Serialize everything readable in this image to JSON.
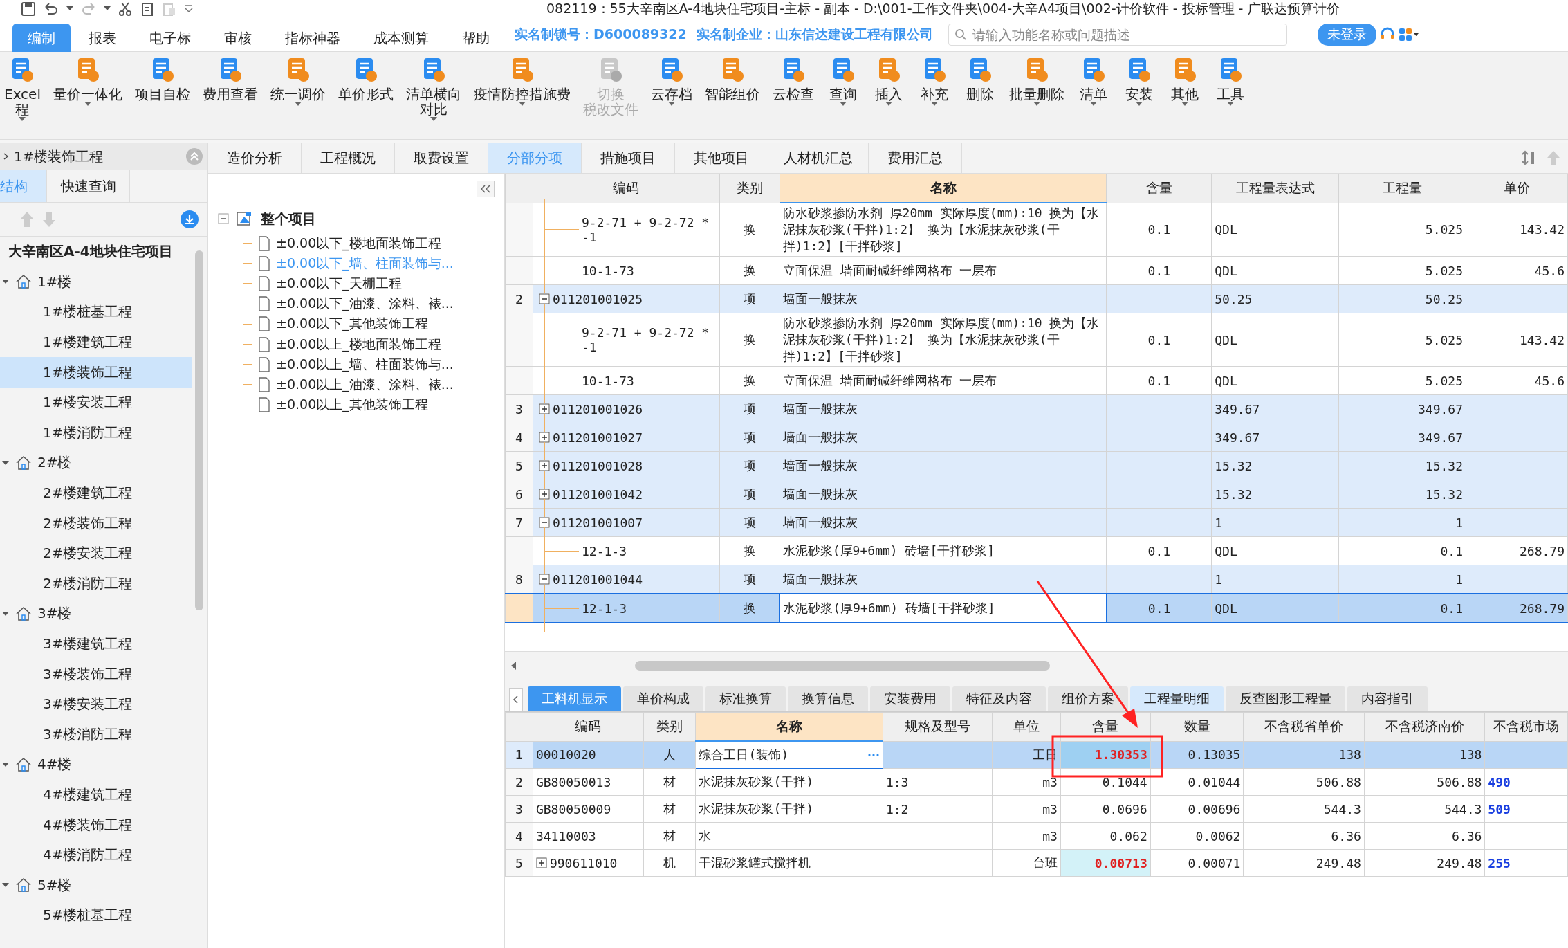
{
  "window": {
    "title": "082119：55大辛南区A-4地块住宅项目-主标 - 副本 - D:\\001-工作文件夹\\004-大辛A4项目\\002-计价软件 - 投标管理 - 广联达预算计价"
  },
  "menu": {
    "tabs": [
      {
        "label": "编制",
        "selected": true
      },
      {
        "label": "报表",
        "selected": false
      },
      {
        "label": "电子标",
        "selected": false
      },
      {
        "label": "审核",
        "selected": false
      },
      {
        "label": "指标神器",
        "selected": false
      },
      {
        "label": "成本测算",
        "selected": false
      },
      {
        "label": "帮助",
        "selected": false
      }
    ],
    "lock_label": "实名制锁号：",
    "lock_value": "D600089322",
    "company_label": "实名制企业：",
    "company_value": "山东信达建设工程有限公司",
    "search": {
      "placeholder": "请输入功能名称或问题描述"
    },
    "login_button": "未登录"
  },
  "toolbar": [
    {
      "lines": [
        "Excel",
        "程"
      ],
      "dropdown": true,
      "disabled": false
    },
    {
      "lines": [
        "量价一体化"
      ],
      "dropdown": true,
      "disabled": false
    },
    {
      "lines": [
        "项目自检"
      ],
      "dropdown": false,
      "disabled": false
    },
    {
      "lines": [
        "费用查看"
      ],
      "dropdown": false,
      "disabled": false
    },
    {
      "lines": [
        "统一调价"
      ],
      "dropdown": true,
      "disabled": false
    },
    {
      "lines": [
        "单价形式"
      ],
      "dropdown": false,
      "disabled": false
    },
    {
      "lines": [
        "清单横向",
        "对比"
      ],
      "dropdown": true,
      "disabled": false
    },
    {
      "lines": [
        "疫情防控措施费"
      ],
      "dropdown": true,
      "disabled": false
    },
    {
      "lines": [
        "切换",
        "税改文件"
      ],
      "dropdown": false,
      "disabled": true
    },
    {
      "lines": [
        "云存档"
      ],
      "dropdown": true,
      "disabled": false
    },
    {
      "lines": [
        "智能组价"
      ],
      "dropdown": false,
      "disabled": false
    },
    {
      "lines": [
        "云检查"
      ],
      "dropdown": false,
      "disabled": false
    },
    {
      "lines": [
        "查询"
      ],
      "dropdown": true,
      "disabled": false
    },
    {
      "lines": [
        "插入"
      ],
      "dropdown": true,
      "disabled": false
    },
    {
      "lines": [
        "补充"
      ],
      "dropdown": true,
      "disabled": false
    },
    {
      "lines": [
        "删除"
      ],
      "dropdown": false,
      "disabled": false
    },
    {
      "lines": [
        "批量删除"
      ],
      "dropdown": true,
      "disabled": false
    },
    {
      "lines": [
        "清单"
      ],
      "dropdown": true,
      "disabled": false
    },
    {
      "lines": [
        "安装"
      ],
      "dropdown": true,
      "disabled": false
    },
    {
      "lines": [
        "其他"
      ],
      "dropdown": true,
      "disabled": false
    },
    {
      "lines": [
        "工具"
      ],
      "dropdown": true,
      "disabled": false
    }
  ],
  "left_panel": {
    "header": "1#楼装饰工程",
    "tabs": [
      {
        "label": "结构",
        "selected": true
      },
      {
        "label": "快速查询",
        "selected": false
      }
    ],
    "tree": {
      "label": "大辛南区A-4地块住宅项目",
      "children": [
        {
          "label": "1#楼",
          "expanded": true,
          "children": [
            {
              "label": "1#楼桩基工程",
              "selected": false
            },
            {
              "label": "1#楼建筑工程",
              "selected": false
            },
            {
              "label": "1#楼装饰工程",
              "selected": true
            },
            {
              "label": "1#楼安装工程",
              "selected": false
            },
            {
              "label": "1#楼消防工程",
              "selected": false
            }
          ]
        },
        {
          "label": "2#楼",
          "expanded": true,
          "children": [
            {
              "label": "2#楼建筑工程",
              "selected": false
            },
            {
              "label": "2#楼装饰工程",
              "selected": false
            },
            {
              "label": "2#楼安装工程",
              "selected": false
            },
            {
              "label": "2#楼消防工程",
              "selected": false
            }
          ]
        },
        {
          "label": "3#楼",
          "expanded": true,
          "children": [
            {
              "label": "3#楼建筑工程",
              "selected": false
            },
            {
              "label": "3#楼装饰工程",
              "selected": false
            },
            {
              "label": "3#楼安装工程",
              "selected": false
            },
            {
              "label": "3#楼消防工程",
              "selected": false
            }
          ]
        },
        {
          "label": "4#楼",
          "expanded": true,
          "children": [
            {
              "label": "4#楼建筑工程",
              "selected": false
            },
            {
              "label": "4#楼装饰工程",
              "selected": false
            },
            {
              "label": "4#楼消防工程",
              "selected": false
            }
          ]
        },
        {
          "label": "5#楼",
          "expanded": true,
          "children": [
            {
              "label": "5#楼桩基工程",
              "selected": false
            }
          ]
        }
      ]
    }
  },
  "section_tree": {
    "root": "整个项目",
    "expanded": true,
    "items": [
      {
        "label": "±0.00以下_楼地面装饰工程",
        "selected": false
      },
      {
        "label": "±0.00以下_墙、柱面装饰与...",
        "selected": true
      },
      {
        "label": "±0.00以下_天棚工程",
        "selected": false
      },
      {
        "label": "±0.00以下_油漆、涂料、裱...",
        "selected": false
      },
      {
        "label": "±0.00以下_其他装饰工程",
        "selected": false
      },
      {
        "label": "±0.00以上_楼地面装饰工程",
        "selected": false
      },
      {
        "label": "±0.00以上_墙、柱面装饰与...",
        "selected": false
      },
      {
        "label": "±0.00以上_油漆、涂料、裱...",
        "selected": false
      },
      {
        "label": "±0.00以上_其他装饰工程",
        "selected": false
      }
    ]
  },
  "main_tabs": [
    {
      "label": "造价分析",
      "selected": false
    },
    {
      "label": "工程概况",
      "selected": false
    },
    {
      "label": "取费设置",
      "selected": false
    },
    {
      "label": "分部分项",
      "selected": true
    },
    {
      "label": "措施项目",
      "selected": false
    },
    {
      "label": "其他项目",
      "selected": false
    },
    {
      "label": "人材机汇总",
      "selected": false
    },
    {
      "label": "费用汇总",
      "selected": false
    }
  ],
  "main_table": {
    "columns": [
      "编码",
      "类别",
      "名称",
      "含量",
      "工程量表达式",
      "工程量",
      "单价"
    ],
    "rows": [
      {
        "kind": "sub",
        "num": "",
        "code": "9-2-71 + 9-2-72 * -1",
        "type": "换",
        "name": "防水砂浆掺防水剂 厚20mm  实际厚度(mm):10  换为【水泥抹灰砂浆(干拌)1:2】  换为【水泥抹灰砂浆(干拌)1:2】[干拌砂浆]",
        "content": "0.1",
        "expr": "QDL",
        "qty": "5.025",
        "price": "143.42",
        "selected": false
      },
      {
        "kind": "sub",
        "num": "",
        "code": "10-1-73",
        "type": "换",
        "name": "立面保温 墙面耐碱纤维网格布 一层布",
        "content": "0.1",
        "expr": "QDL",
        "qty": "5.025",
        "price": "45.6",
        "selected": false
      },
      {
        "kind": "item",
        "num": "2",
        "expanded": true,
        "code": "011201001025",
        "type": "项",
        "name": "墙面一般抹灰",
        "content": "",
        "expr": "50.25",
        "qty": "50.25",
        "price": "",
        "selected": false
      },
      {
        "kind": "sub",
        "num": "",
        "code": "9-2-71 + 9-2-72 * -1",
        "type": "换",
        "name": "防水砂浆掺防水剂 厚20mm  实际厚度(mm):10  换为【水泥抹灰砂浆(干拌)1:2】  换为【水泥抹灰砂浆(干拌)1:2】[干拌砂浆]",
        "content": "0.1",
        "expr": "QDL",
        "qty": "5.025",
        "price": "143.42",
        "selected": false
      },
      {
        "kind": "sub",
        "num": "",
        "code": "10-1-73",
        "type": "换",
        "name": "立面保温 墙面耐碱纤维网格布 一层布",
        "content": "0.1",
        "expr": "QDL",
        "qty": "5.025",
        "price": "45.6",
        "selected": false
      },
      {
        "kind": "item",
        "num": "3",
        "expanded": false,
        "code": "011201001026",
        "type": "项",
        "name": "墙面一般抹灰",
        "content": "",
        "expr": "349.67",
        "qty": "349.67",
        "price": "",
        "selected": false
      },
      {
        "kind": "item",
        "num": "4",
        "expanded": false,
        "code": "011201001027",
        "type": "项",
        "name": "墙面一般抹灰",
        "content": "",
        "expr": "349.67",
        "qty": "349.67",
        "price": "",
        "selected": false
      },
      {
        "kind": "item",
        "num": "5",
        "expanded": false,
        "code": "011201001028",
        "type": "项",
        "name": "墙面一般抹灰",
        "content": "",
        "expr": "15.32",
        "qty": "15.32",
        "price": "",
        "selected": false
      },
      {
        "kind": "item",
        "num": "6",
        "expanded": false,
        "code": "011201001042",
        "type": "项",
        "name": "墙面一般抹灰",
        "content": "",
        "expr": "15.32",
        "qty": "15.32",
        "price": "",
        "selected": false
      },
      {
        "kind": "item",
        "num": "7",
        "expanded": true,
        "code": "011201001007",
        "type": "项",
        "name": "墙面一般抹灰",
        "content": "",
        "expr": "1",
        "qty": "1",
        "price": "",
        "selected": false
      },
      {
        "kind": "sub",
        "num": "",
        "code": "12-1-3",
        "type": "换",
        "name": "水泥砂浆(厚9+6mm) 砖墙[干拌砂浆]",
        "content": "0.1",
        "expr": "QDL",
        "qty": "0.1",
        "price": "268.79",
        "selected": false
      },
      {
        "kind": "item",
        "num": "8",
        "expanded": true,
        "code": "011201001044",
        "type": "项",
        "name": "墙面一般抹灰",
        "content": "",
        "expr": "1",
        "qty": "1",
        "price": "",
        "selected": false
      },
      {
        "kind": "sub",
        "num": "",
        "code": "12-1-3",
        "type": "换",
        "name": "水泥砂浆(厚9+6mm) 砖墙[干拌砂浆]",
        "content": "0.1",
        "expr": "QDL",
        "qty": "0.1",
        "price": "268.79",
        "selected": true
      }
    ]
  },
  "bottom_tabs": [
    {
      "label": "工料机显示",
      "selected": true,
      "highlighted": false
    },
    {
      "label": "单价构成",
      "selected": false,
      "highlighted": false
    },
    {
      "label": "标准换算",
      "selected": false,
      "highlighted": false
    },
    {
      "label": "换算信息",
      "selected": false,
      "highlighted": false
    },
    {
      "label": "安装费用",
      "selected": false,
      "highlighted": false
    },
    {
      "label": "特征及内容",
      "selected": false,
      "highlighted": false
    },
    {
      "label": "组价方案",
      "selected": false,
      "highlighted": false
    },
    {
      "label": "工程量明细",
      "selected": false,
      "highlighted": true
    },
    {
      "label": "反查图形工程量",
      "selected": false,
      "highlighted": false
    },
    {
      "label": "内容指引",
      "selected": false,
      "highlighted": false
    }
  ],
  "bottom_table": {
    "columns": [
      "编码",
      "类别",
      "名称",
      "规格及型号",
      "单位",
      "含量",
      "数量",
      "不含税省单价",
      "不含税济南价",
      "不含税市场"
    ],
    "rows": [
      {
        "num": "1",
        "expandable": false,
        "code": "00010020",
        "type": "人",
        "name": "综合工日(装饰)",
        "spec": "",
        "unit": "工日",
        "content": "1.30353",
        "content_changed": true,
        "qty": "0.13035",
        "p1": "138",
        "p2": "138",
        "market": "",
        "selected": true
      },
      {
        "num": "2",
        "expandable": false,
        "code": "GB80050013",
        "type": "材",
        "name": "水泥抹灰砂浆(干拌)",
        "spec": "1:3",
        "unit": "m3",
        "content": "0.1044",
        "content_changed": false,
        "qty": "0.01044",
        "p1": "506.88",
        "p2": "506.88",
        "market": "490",
        "selected": false
      },
      {
        "num": "3",
        "expandable": false,
        "code": "GB80050009",
        "type": "材",
        "name": "水泥抹灰砂浆(干拌)",
        "spec": "1:2",
        "unit": "m3",
        "content": "0.0696",
        "content_changed": false,
        "qty": "0.00696",
        "p1": "544.3",
        "p2": "544.3",
        "market": "509",
        "selected": false
      },
      {
        "num": "4",
        "expandable": false,
        "code": "34110003",
        "type": "材",
        "name": "水",
        "spec": "",
        "unit": "m3",
        "content": "0.062",
        "content_changed": false,
        "qty": "0.0062",
        "p1": "6.36",
        "p2": "6.36",
        "market": "",
        "selected": false
      },
      {
        "num": "5",
        "expandable": true,
        "code": "990611010",
        "type": "机",
        "name": "干混砂浆罐式搅拌机",
        "spec": "",
        "unit": "台班",
        "content": "0.00713",
        "content_changed": true,
        "qty": "0.00071",
        "p1": "249.48",
        "p2": "249.48",
        "market": "255",
        "selected": false
      }
    ]
  }
}
